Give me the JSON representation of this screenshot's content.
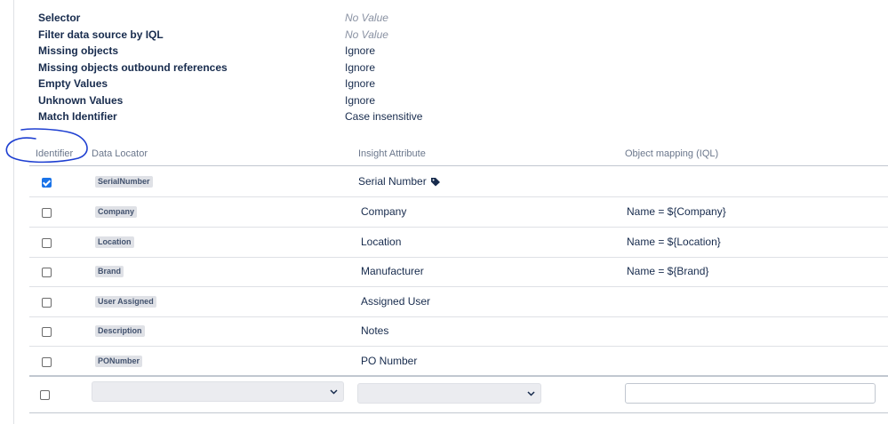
{
  "properties": [
    {
      "label": "Selector",
      "value": "No Value",
      "novalue": true
    },
    {
      "label": "Filter data source by IQL",
      "value": "No Value",
      "novalue": true
    },
    {
      "label": "Missing objects",
      "value": "Ignore",
      "novalue": false
    },
    {
      "label": "Missing objects outbound references",
      "value": "Ignore",
      "novalue": false
    },
    {
      "label": "Empty Values",
      "value": "Ignore",
      "novalue": false
    },
    {
      "label": "Unknown Values",
      "value": "Ignore",
      "novalue": false
    },
    {
      "label": "Match Identifier",
      "value": "Case insensitive",
      "novalue": false
    }
  ],
  "table": {
    "headers": {
      "identifier": "Identifier",
      "data_locator": "Data Locator",
      "insight_attribute": "Insight Attribute",
      "object_mapping": "Object mapping (IQL)"
    },
    "rows": [
      {
        "identifier": true,
        "data_locator": "SerialNumber",
        "attribute": "Serial Number",
        "mapping": "",
        "tag_icon": "label-tag-icon"
      },
      {
        "identifier": false,
        "data_locator": "Company",
        "attribute": "Company",
        "mapping": "Name = ${Company}"
      },
      {
        "identifier": false,
        "data_locator": "Location",
        "attribute": "Location",
        "mapping": "Name = ${Location}"
      },
      {
        "identifier": false,
        "data_locator": "Brand",
        "attribute": "Manufacturer",
        "mapping": "Name = ${Brand}"
      },
      {
        "identifier": false,
        "data_locator": "User Assigned",
        "attribute": "Assigned User",
        "mapping": ""
      },
      {
        "identifier": false,
        "data_locator": "Description",
        "attribute": "Notes",
        "mapping": ""
      },
      {
        "identifier": false,
        "data_locator": "PONumber",
        "attribute": "PO Number",
        "mapping": ""
      }
    ],
    "new_row": {
      "identifier": false,
      "data_locator_value": "",
      "attribute_value": "",
      "mapping_value": ""
    }
  },
  "colors": {
    "accent": "#1a73e8",
    "annotation": "#1e3fd1"
  }
}
